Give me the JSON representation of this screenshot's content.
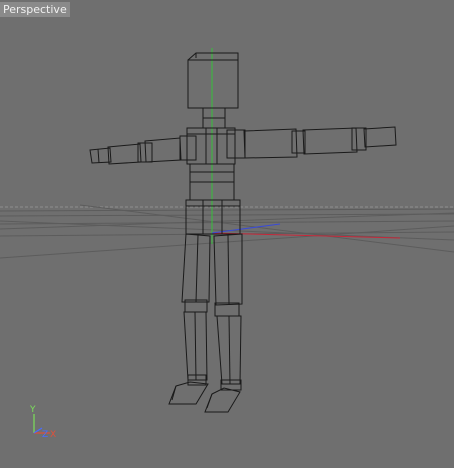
{
  "viewport": {
    "label": "Perspective",
    "background": "#6f6f6f"
  },
  "gizmo": {
    "y_label": "Y",
    "x_label": "X",
    "z_label": "Z",
    "y_color": "#7be05a",
    "x_color": "#e0503a",
    "z_color": "#4a6cff"
  },
  "colors": {
    "wire": "#1a1a1a",
    "grid": "#5c5c5c",
    "horizon": "#9a9a9a",
    "axis_y": "#35c23a",
    "axis_x": "#c6283a",
    "axis_z": "#3a4bd6"
  }
}
